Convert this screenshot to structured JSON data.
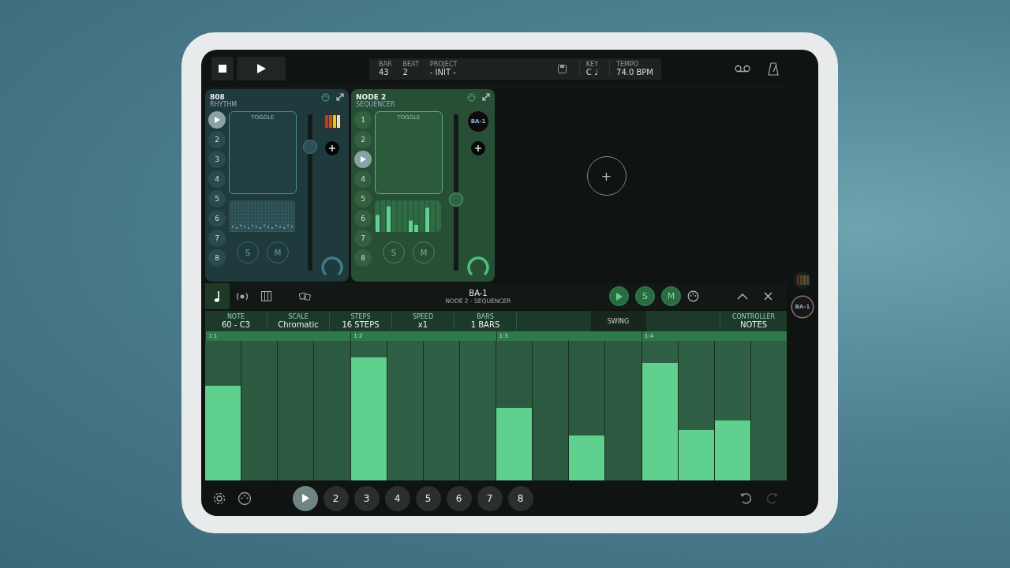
{
  "transport": {
    "fields": [
      {
        "label": "BAR",
        "value": "43"
      },
      {
        "label": "BEAT",
        "value": "2"
      },
      {
        "label": "PROJECT",
        "value": "- INIT -"
      }
    ],
    "key_label": "KEY",
    "key": "C ♩",
    "tempo_label": "TEMPO",
    "tempo": "74.0 BPM"
  },
  "nodes": [
    {
      "name": "808",
      "type": "RHYTHM",
      "kind": "rhythm",
      "pad_title": "TOGGLE",
      "volume": {
        "level": 0.82
      },
      "solo": "S",
      "mute": "M",
      "pads": [
        {
          "selected": true
        },
        {
          "label": "2",
          "selected": false
        },
        {
          "label": "3",
          "selected": false
        },
        {
          "label": "4",
          "selected": false
        },
        {
          "label": "5",
          "selected": false
        },
        {
          "label": "6",
          "selected": false
        },
        {
          "label": "7",
          "selected": false
        },
        {
          "label": "8",
          "selected": false
        }
      ]
    },
    {
      "name": "NODE 2",
      "type": "SEQUENCER",
      "kind": "sequencer",
      "instrument": "BA-1",
      "pad_title": "TOGGLE",
      "volume": {
        "level": 0.45
      },
      "solo": "S",
      "mute": "M",
      "pads": [
        {
          "label": "1",
          "selected": false
        },
        {
          "label": "2",
          "selected": false
        },
        {
          "selected": true
        },
        {
          "label": "4",
          "selected": false
        },
        {
          "label": "5",
          "selected": false
        },
        {
          "label": "6",
          "selected": false
        },
        {
          "label": "7",
          "selected": false
        },
        {
          "label": "8",
          "selected": false
        }
      ]
    }
  ],
  "add_node": "+",
  "side_instruments": [
    {
      "kind": "mixer",
      "selected": false
    },
    {
      "kind": "badge",
      "label": "BA-1",
      "selected": true
    }
  ],
  "editor": {
    "title": "BA-1",
    "subtitle": "NODE 2 - SEQUENCER",
    "solo": "S",
    "mute": "M",
    "tabs": [
      {
        "kind": "note",
        "selected": true
      },
      {
        "kind": "wave",
        "selected": false
      },
      {
        "kind": "piano",
        "selected": false
      },
      {
        "kind": "dice",
        "selected": false
      }
    ],
    "params": [
      {
        "label": "NOTE",
        "value": "60 - C3"
      },
      {
        "label": "SCALE",
        "value": "Chromatic"
      },
      {
        "label": "STEPS",
        "value": "16 STEPS"
      },
      {
        "label": "SPEED",
        "value": "x1"
      },
      {
        "label": "BARS",
        "value": "1 BARS"
      }
    ],
    "swing": "SWING",
    "controller": {
      "label": "CONTROLLER",
      "value": "NOTES"
    },
    "ruler": [
      "1:1",
      "1:2",
      "1:3",
      "1:4"
    ],
    "steps": [
      {
        "on": true,
        "level": 0.68
      },
      {
        "on": false
      },
      {
        "on": false
      },
      {
        "on": false
      },
      {
        "on": true,
        "level": 0.88
      },
      {
        "on": false
      },
      {
        "on": false
      },
      {
        "on": false
      },
      {
        "on": true,
        "level": 0.52
      },
      {
        "on": false
      },
      {
        "on": true,
        "level": 0.32
      },
      {
        "on": false
      },
      {
        "on": true,
        "level": 0.84
      },
      {
        "on": true,
        "level": 0.36
      },
      {
        "on": true,
        "level": 0.43
      },
      {
        "on": false
      }
    ]
  },
  "scenes": [
    {
      "selected": true
    },
    {
      "label": "2",
      "selected": false
    },
    {
      "label": "3",
      "selected": false
    },
    {
      "label": "4",
      "selected": false
    },
    {
      "label": "5",
      "selected": false
    },
    {
      "label": "6",
      "selected": false
    },
    {
      "label": "7",
      "selected": false
    },
    {
      "label": "8",
      "selected": false
    }
  ]
}
